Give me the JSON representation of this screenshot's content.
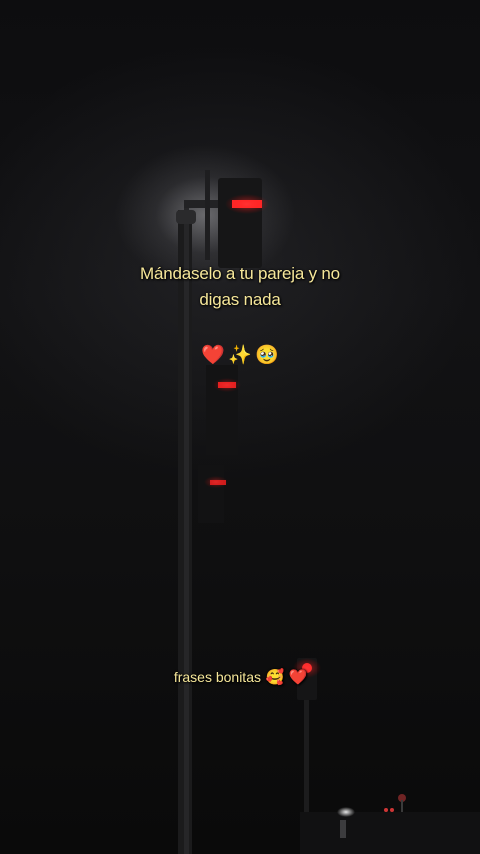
{
  "caption": {
    "line1": "Mándaselo a tu pareja y no",
    "line2": "digas nada"
  },
  "emojis": {
    "heart": "❤️",
    "sparkles": "✨",
    "teary_face": "🥹"
  },
  "footer": {
    "text": "frases bonitas",
    "emoji_smile_hearts": "🥰",
    "emoji_heart": "❤️"
  },
  "colors": {
    "caption_text": "#f6e79a",
    "signal_red": "#ff2a2a",
    "background": "#0b0b0c"
  }
}
